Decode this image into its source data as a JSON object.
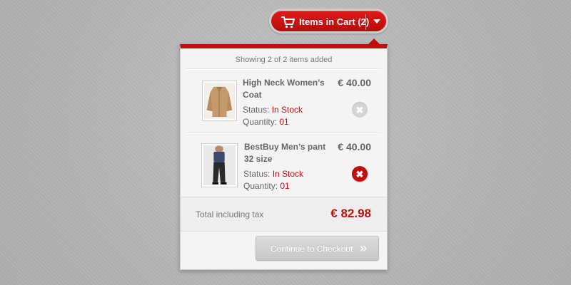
{
  "cart_button": {
    "label": "Items in Cart (2)",
    "icon": "shopping-cart-icon",
    "toggle_icon": "caret-down-icon"
  },
  "panel": {
    "summary": "Showing 2 of 2 items added",
    "items": [
      {
        "name": "High Neck Women’s Coat",
        "price": "€ 40.00",
        "status_label": "Status:",
        "status_value": "In Stock",
        "quantity_label": "Quantity:",
        "quantity_value": "01",
        "thumbnail_icon": "coat-thumbnail",
        "remove_icon": "close-icon",
        "remove_state": "disabled"
      },
      {
        "name": "BestBuy Men’s pant 32 size",
        "price": "€ 40.00",
        "status_label": "Status:",
        "status_value": "In Stock",
        "quantity_label": "Quantity:",
        "quantity_value": "01",
        "thumbnail_icon": "pants-thumbnail",
        "remove_icon": "close-icon",
        "remove_state": "active"
      }
    ],
    "total_label": "Total including tax",
    "total_value": "€ 82.98",
    "checkout_label": "Continue to Checkout",
    "checkout_icon": "double-chevron-right-icon"
  },
  "colors": {
    "accent": "#c30e0e",
    "text": "#666666",
    "panel_bg": "#f4f4f4"
  }
}
